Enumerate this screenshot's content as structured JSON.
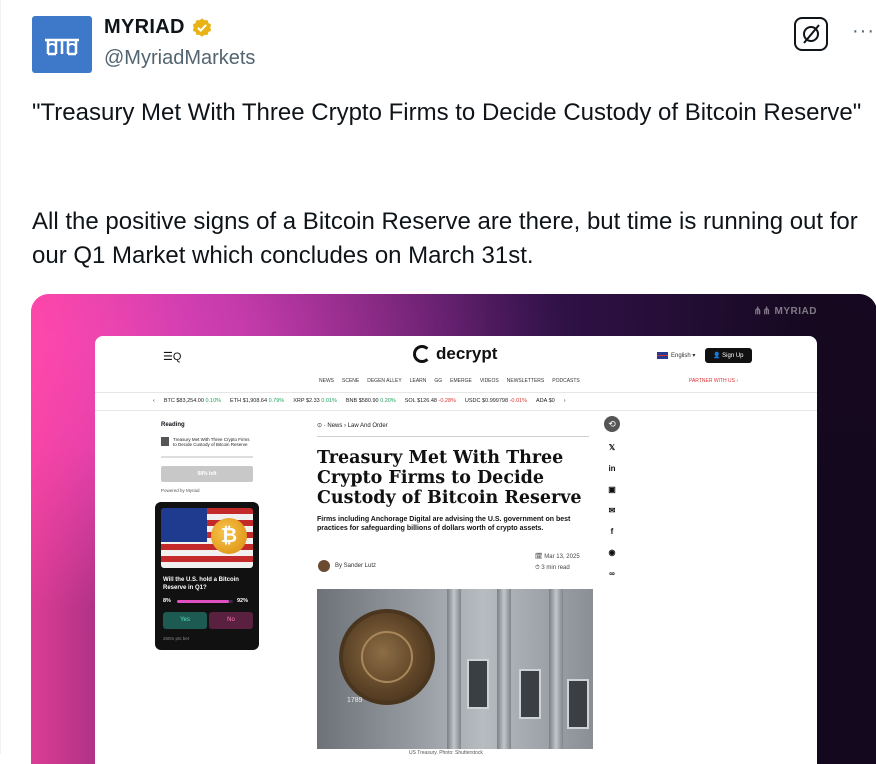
{
  "tweet": {
    "display_name": "MYRIAD",
    "handle": "@MyriadMarkets",
    "more_label": "···",
    "text_1": "\"Treasury Met With Three Crypto Firms to Decide Custody of Bitcoin Reserve\"",
    "text_2": "All the positive signs of a Bitcoin Reserve are there, but time is running out for our Q1 Market which concludes on March 31st.",
    "grok_icon": "grok-icon",
    "verified_icon": "verified-badge-icon"
  },
  "media": {
    "watermark": "MYRIAD",
    "site": {
      "logo_text": "decrypt",
      "menu_label": "☰Q",
      "lang_label": "English ▾",
      "signup_label": "Sign Up",
      "partner_label": "PARTNER WITH US ›",
      "nav": [
        "NEWS",
        "SCENE",
        "DEGEN ALLEY",
        "LEARN",
        "GG",
        "EMERGE",
        "VIDEOS",
        "NEWSLETTERS",
        "PODCASTS"
      ],
      "ticker": [
        {
          "sym": "BTC",
          "price": "$83,254.00",
          "chg": "0.10%",
          "dir": "up"
        },
        {
          "sym": "ETH",
          "price": "$1,908.64",
          "chg": "0.79%",
          "dir": "up"
        },
        {
          "sym": "XRP",
          "price": "$2.33",
          "chg": "0.01%",
          "dir": "up"
        },
        {
          "sym": "BNB",
          "price": "$580.90",
          "chg": "0.20%",
          "dir": "up"
        },
        {
          "sym": "SOL",
          "price": "$126.48",
          "chg": "-0.28%",
          "dir": "down"
        },
        {
          "sym": "USDC",
          "price": "$0.999798",
          "chg": "-0.01%",
          "dir": "down"
        },
        {
          "sym": "ADA",
          "price": "$0",
          "chg": "",
          "dir": "up"
        }
      ],
      "ticker_prev": "‹",
      "ticker_next": "›",
      "reading": {
        "title": "Reading",
        "item": "Treasury Met With Three Crypto Firms to Decide Custody of Bitcoin Reserve",
        "left_label": "98% left",
        "powered": "Powered by Myriad"
      },
      "market_card": {
        "question": "Will the U.S. hold a Bitcoin Reserve in Q1?",
        "coin_symbol": "₿",
        "pct_low": "8%",
        "pct_high": "92%",
        "progress_fraction": 0.92,
        "yes_label": "Yes",
        "no_label": "No",
        "volume": "260m pts bet"
      },
      "article": {
        "breadcrumb": "News › Law And Order",
        "headline": "Treasury Met With Three Crypto Firms to Decide Custody of Bitcoin Reserve",
        "subhead": "Firms including Anchorage Digital are advising the U.S. government on best practices for safeguarding billions of dollars worth of crypto assets.",
        "author": "By Sander Lutz",
        "date": "Mar 13, 2025",
        "read_time": "3 min read",
        "seal_year": "1789",
        "caption": "US Treasury. Photo: Shutterstock"
      },
      "share_icons": [
        "share-icon",
        "x-icon",
        "linkedin-icon",
        "flipboard-icon",
        "email-icon",
        "facebook-icon",
        "reddit-icon",
        "link-icon"
      ]
    }
  }
}
